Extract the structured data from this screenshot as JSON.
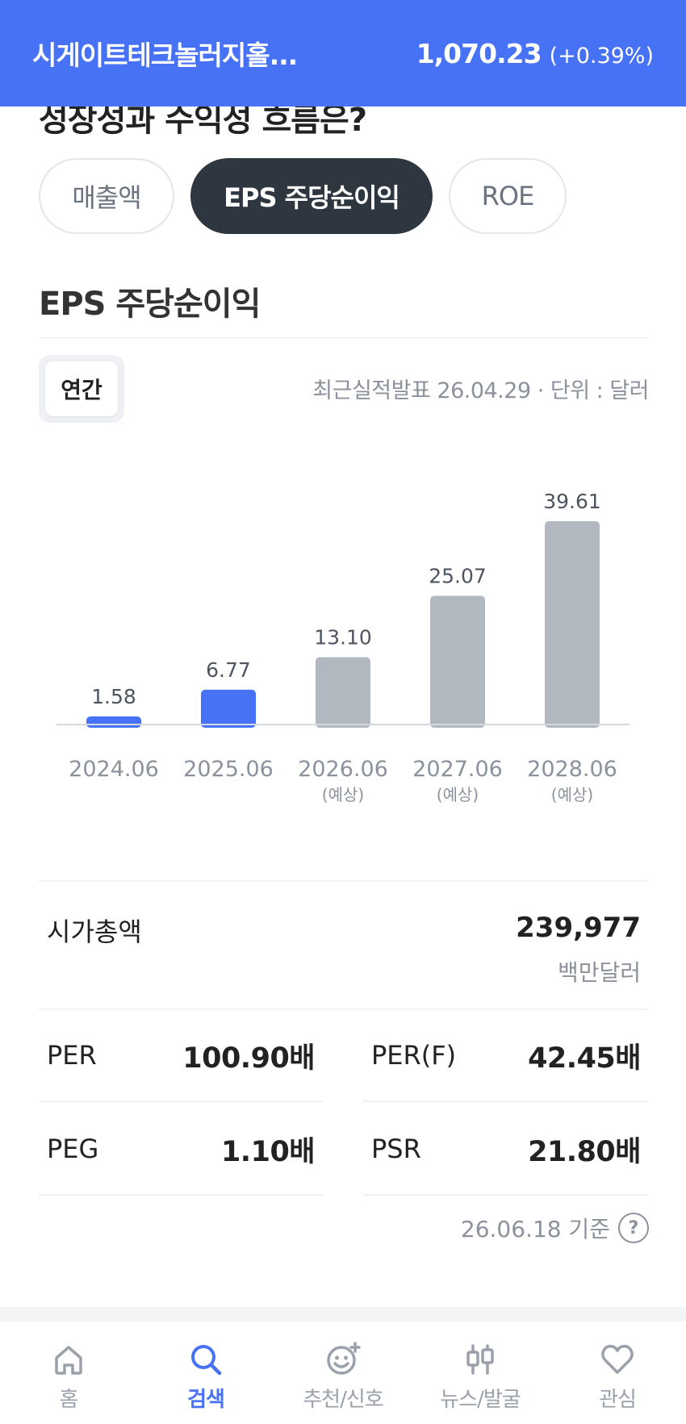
{
  "header": {
    "title": "시게이트테크놀러지홀...",
    "price": "1,070.23",
    "change": "(+0.39%)"
  },
  "section": {
    "heading": "성장성과 수익성 흐름은?"
  },
  "tabs": [
    {
      "label": "매출액",
      "active": false
    },
    {
      "label": "EPS 주당순이익",
      "active": true
    },
    {
      "label": "ROE",
      "active": false
    }
  ],
  "chart_header": {
    "title": "EPS 주당순이익",
    "period": "연간",
    "meta": "최근실적발표 26.04.29 · 단위 : 달러"
  },
  "chart_data": {
    "type": "bar",
    "categories": [
      "2024.06",
      "2025.06",
      "2026.06",
      "2027.06",
      "2028.06"
    ],
    "values": [
      1.58,
      6.77,
      13.1,
      25.07,
      39.61
    ],
    "value_labels": [
      "1.58",
      "6.77",
      "13.10",
      "25.07",
      "39.61"
    ],
    "sublabels": [
      "",
      "",
      "(예상)",
      "(예상)",
      "(예상)"
    ],
    "estimated": [
      false,
      false,
      true,
      true,
      true
    ],
    "ylim": [
      0,
      39.61
    ],
    "grid": false,
    "colors": {
      "actual": "#4772f5",
      "estimate": "#b1b8c0",
      "baseline": "#d5d9de",
      "label": "#4e5560",
      "tick": "#8b929c"
    }
  },
  "market_cap": {
    "label": "시가총액",
    "value": "239,977",
    "unit": "백만달러"
  },
  "metrics": {
    "per": {
      "label": "PER",
      "value": "100.90배"
    },
    "per_f": {
      "label": "PER(F)",
      "value": "42.45배"
    },
    "peg": {
      "label": "PEG",
      "value": "1.10배"
    },
    "psr": {
      "label": "PSR",
      "value": "21.80배"
    }
  },
  "basis": {
    "text": "26.06.18 기준",
    "help": "?"
  },
  "nav": [
    {
      "label": "홈",
      "icon": "home-icon",
      "active": false
    },
    {
      "label": "검색",
      "icon": "search-icon",
      "active": true
    },
    {
      "label": "추천/신호",
      "icon": "smile-sparkle-icon",
      "active": false
    },
    {
      "label": "뉴스/발굴",
      "icon": "candlestick-icon",
      "active": false
    },
    {
      "label": "관심",
      "icon": "heart-icon",
      "active": false
    }
  ],
  "colors": {
    "brand": "#4772f5",
    "dark_tab": "#2e3640"
  }
}
